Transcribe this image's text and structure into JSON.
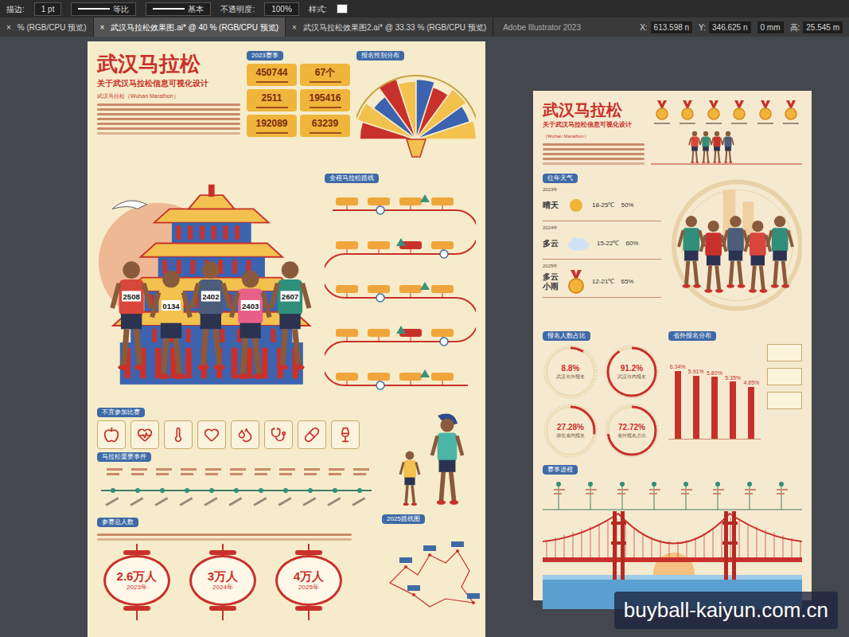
{
  "toolbar": {
    "stroke_label": "描边:",
    "stroke_value": "1 pt",
    "profile": "等比",
    "brush": "基本",
    "opacity_label": "不透明度:",
    "opacity_value": "100%",
    "style_label": "样式:"
  },
  "tabs": [
    {
      "label": "% (RGB/CPU 预览)",
      "selected": false
    },
    {
      "label": "武汉马拉松效果图.ai* @ 40 % (RGB/CPU 预览)",
      "selected": true
    },
    {
      "label": "武汉马拉松效果图2.ai* @ 33.33 % (RGB/CPU 预览)",
      "selected": false
    }
  ],
  "tab_close": "×",
  "app_title": "Adobe Illustrator 2023",
  "coords": [
    {
      "label": "X:",
      "value": "613.598 n"
    },
    {
      "label": "Y:",
      "value": "346.625 n"
    },
    {
      "label": "",
      "value": "0 mm"
    },
    {
      "label": "高:",
      "value": "25.545 m"
    }
  ],
  "left_poster": {
    "title": "武汉马拉松",
    "subtitle": "关于武汉马拉松信息可视化设计",
    "intro_lead": "武汉马拉松（Wuhan Marathon）",
    "stats_heading": "2023赛事",
    "stats": [
      "450744",
      "67个",
      "2511",
      "195416",
      "192089",
      "63239"
    ],
    "fan": {
      "heading": "报名性别分布",
      "wedges": [
        {
          "value": 0.8,
          "color": "#c8312b"
        },
        {
          "value": 0.95,
          "color": "#f2c14e"
        },
        {
          "value": 0.7,
          "color": "#3b63b0"
        },
        {
          "value": 1.0,
          "color": "#c8312b"
        },
        {
          "value": 0.85,
          "color": "#f2c14e"
        },
        {
          "value": 0.9,
          "color": "#3b63b0"
        },
        {
          "value": 0.75,
          "color": "#c8312b"
        },
        {
          "value": 0.95,
          "color": "#f2c14e"
        },
        {
          "value": 0.8,
          "color": "#3b63b0"
        },
        {
          "value": 0.9,
          "color": "#f2c14e"
        }
      ]
    },
    "route_heading": "全程马拉松路线",
    "runners": [
      {
        "bib": "2508",
        "color": "#d9463b"
      },
      {
        "bib": "0134",
        "color": "#f2c14e"
      },
      {
        "bib": "2402",
        "color": "#4b5d7a"
      },
      {
        "bib": "2403",
        "color": "#e8608a"
      },
      {
        "bib": "2607",
        "color": "#2f8f7a"
      }
    ],
    "unfit_heading": "不宜参加比赛",
    "events_heading": "马拉松重要事件",
    "total_heading": "参赛总人数",
    "lanterns": [
      {
        "value": "2.6万人",
        "year": "2023年"
      },
      {
        "value": "3万人",
        "year": "2024年"
      },
      {
        "value": "4万人",
        "year": "2025年"
      }
    ],
    "map_heading": "2025路线图"
  },
  "right_poster": {
    "title": "武汉马拉松",
    "subtitle": "关于武汉马拉松信息可视化设计",
    "intro_lead": "（Wuhan Marathon）",
    "weather_heading": "往年天气",
    "weather": [
      {
        "year": "2023年",
        "kind": "sun",
        "condition": "晴天",
        "temp": "18-25℃",
        "humidity": "50%"
      },
      {
        "year": "2024年",
        "kind": "cloud",
        "condition": "多云",
        "temp": "15-22℃",
        "humidity": "60%"
      },
      {
        "year": "2025年",
        "kind": "medal",
        "condition": "多云小雨",
        "temp": "12-21℃",
        "humidity": "65%"
      }
    ],
    "share_heading": "报名人数占比",
    "donuts": [
      {
        "value": "8.8%",
        "label": "武汉市外报名",
        "level": 0.088
      },
      {
        "value": "91.2%",
        "label": "武汉市内报名",
        "level": 0.912
      },
      {
        "value": "27.28%",
        "label": "湖北省内报名",
        "level": 0.2728
      },
      {
        "value": "72.72%",
        "label": "省外报名占比",
        "level": 0.7272
      }
    ],
    "provinces_heading": "省外报名分布",
    "bars": {
      "values": [
        6.34,
        5.91,
        5.8,
        5.35,
        4.85
      ],
      "labels": [
        "6.34%",
        "5.91%",
        "5.80%",
        "5.35%",
        "4.85%"
      ]
    },
    "progress_heading": "赛事进程"
  },
  "watermark": "buyball-kaiyun.com.cn"
}
